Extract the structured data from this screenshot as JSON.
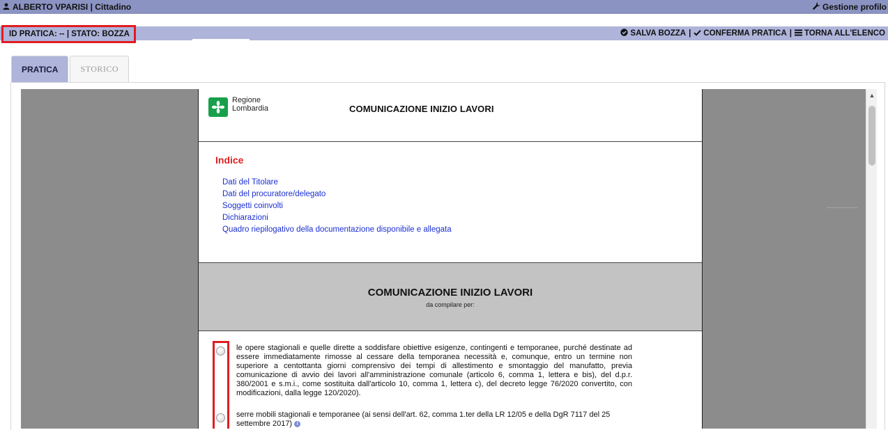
{
  "topbar": {
    "user_icon": "user-icon",
    "user_label": "ALBERTO VPARISI | Cittadino",
    "profile_icon": "wrench-icon",
    "profile_label": "Gestione profilo"
  },
  "status": {
    "id_stato": "ID PRATICA: -- |  STATO: BOZZA"
  },
  "actions": {
    "save_icon": "check-circle-icon",
    "save_label": "SALVA BOZZA",
    "sep1": "|",
    "confirm_icon": "check-icon",
    "confirm_label": "CONFERMA PRATICA",
    "sep2": "|",
    "back_icon": "list-icon",
    "back_label": "TORNA ALL'ELENCO"
  },
  "tabs": [
    {
      "label": "PRATICA",
      "active": true
    },
    {
      "label": "STORICO",
      "active": false
    }
  ],
  "document": {
    "region_line1": "Regione",
    "region_line2": "Lombardia",
    "title": "COMUNICAZIONE INIZIO LAVORI",
    "index_title": "Indice",
    "index_items": [
      "Dati del Titolare",
      "Dati del procuratore/delegato",
      "Soggetti coinvolti",
      "Dichiarazioni",
      "Quadro riepilogativo della documentazione disponibile e allegata"
    ],
    "section_title": "COMUNICAZIONE INIZIO LAVORI",
    "section_subtitle": "da compilare per:",
    "option1": "le opere stagionali e quelle dirette a soddisfare obiettive esigenze, contingenti e temporanee, purché destinate ad essere immediatamente rimosse al cessare della temporanea necessità e, comunque, entro un termine non superiore a centottanta giorni comprensivo dei tempi di allestimento e smontaggio del manufatto, previa comunicazione di avvio dei lavori all'amministrazione comunale (articolo 6, comma 1, lettera e bis), del d.p.r. 380/2001 e s.m.i., come sostituita dall'articolo 10, comma 1, lettera c), del decreto legge 76/2020 convertito, con modificazioni, dalla legge 120/2020).",
    "option2": "serre mobili stagionali e temporanee (ai sensi dell'art. 62, comma 1.ter della LR 12/05 e della DgR 7117 del 25 settembre 2017)"
  },
  "colors": {
    "topbar": "#8b93c2",
    "statusbar": "#aeb4da",
    "highlight": "#e11b22",
    "link": "#1a2fd0",
    "index_title": "#e02020"
  }
}
